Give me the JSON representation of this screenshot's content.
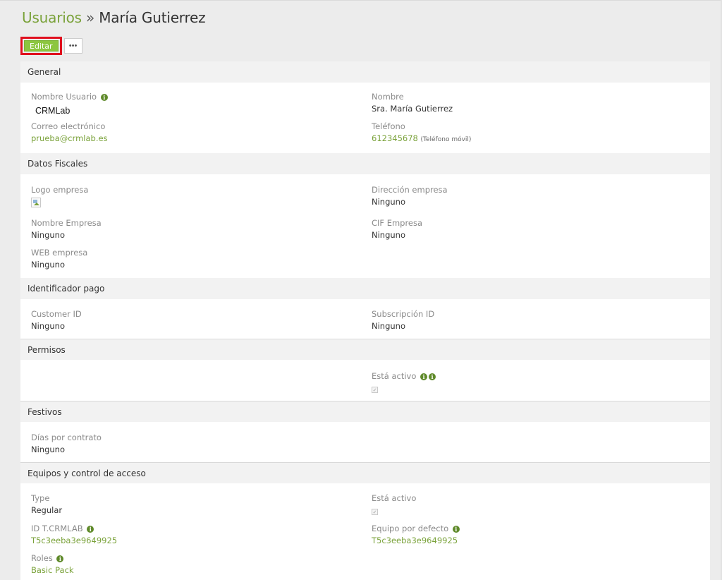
{
  "breadcrumb": {
    "parent": "Usuarios",
    "separator": "»",
    "current": "María Gutierrez"
  },
  "toolbar": {
    "edit_label": "Editar",
    "more_label": "•••"
  },
  "sections": {
    "general": {
      "title": "General",
      "username_label": "Nombre Usuario",
      "username_value": "CRMLab",
      "email_label": "Correo electrónico",
      "email_value": "prueba@crmlab.es",
      "name_label": "Nombre",
      "name_value": "Sra. María Gutierrez",
      "phone_label": "Teléfono",
      "phone_value": "612345678",
      "phone_type": "(Teléfono móvil)"
    },
    "fiscal": {
      "title": "Datos Fiscales",
      "logo_label": "Logo empresa",
      "address_label": "Dirección empresa",
      "address_value": "Ninguno",
      "company_label": "Nombre Empresa",
      "company_value": "Ninguno",
      "cif_label": "CIF Empresa",
      "cif_value": "Ninguno",
      "web_label": "WEB empresa",
      "web_value": "Ninguno"
    },
    "payment": {
      "title": "Identificador pago",
      "customer_label": "Customer ID",
      "customer_value": "Ninguno",
      "subscription_label": "Subscripción ID",
      "subscription_value": "Ninguno"
    },
    "permissions": {
      "title": "Permisos",
      "active_label": "Está activo"
    },
    "holidays": {
      "title": "Festivos",
      "days_label": "Días por contrato",
      "days_value": "Ninguno"
    },
    "teams": {
      "title": "Equipos y control de acceso",
      "type_label": "Type",
      "type_value": "Regular",
      "active_label": "Está activo",
      "id_label": "ID T.CRMLAB",
      "id_value": "T5c3eeba3e9649925",
      "default_team_label": "Equipo por defecto",
      "default_team_value": "T5c3eeba3e9649925",
      "roles_label": "Roles",
      "roles_value": "Basic Pack"
    }
  },
  "colors": {
    "accent": "#8cc63f",
    "link": "#7aa23a",
    "highlight_border": "#e0101e"
  }
}
